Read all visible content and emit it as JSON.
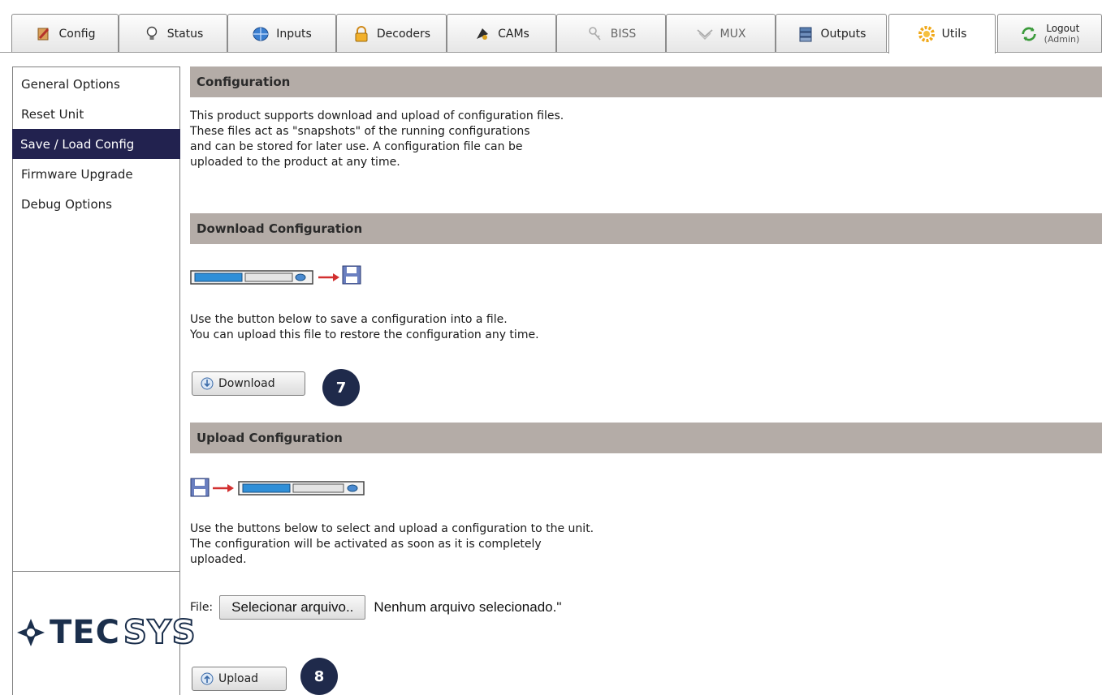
{
  "tabs": [
    {
      "label": "Config",
      "icon": "config-icon"
    },
    {
      "label": "Status",
      "icon": "bulb-icon"
    },
    {
      "label": "Inputs",
      "icon": "globe-icon"
    },
    {
      "label": "Decoders",
      "icon": "lock-icon"
    },
    {
      "label": "CAMs",
      "icon": "cam-icon"
    },
    {
      "label": "BISS",
      "icon": "key-icon"
    },
    {
      "label": "MUX",
      "icon": "mux-icon"
    },
    {
      "label": "Outputs",
      "icon": "server-icon"
    },
    {
      "label": "Utils",
      "icon": "gear-icon"
    }
  ],
  "logout": {
    "label": "Logout",
    "user": "(Admin)"
  },
  "active_tab": "Utils",
  "sidebar": {
    "items": [
      {
        "label": "General Options"
      },
      {
        "label": "Reset Unit"
      },
      {
        "label": "Save / Load Config"
      },
      {
        "label": "Firmware Upgrade"
      },
      {
        "label": "Debug Options"
      }
    ],
    "active": "Save / Load Config"
  },
  "logo": {
    "part1": "TEC",
    "part2": "SYS"
  },
  "sections": {
    "configuration": {
      "title": "Configuration",
      "text": "This product supports download and upload of configuration files.\nThese files act as \"snapshots\" of the running configurations\nand can be stored for later use. A configuration file can be\nuploaded to the product at any time."
    },
    "download": {
      "title": "Download Configuration",
      "text": "Use the button below to save a configuration into a file.\nYou can upload this file to restore the configuration any time.",
      "button_label": "Download",
      "step": "7"
    },
    "upload": {
      "title": "Upload Configuration",
      "text": "Use the buttons below to select and upload a configuration to the unit.\nThe configuration will be activated as soon as it is completely\nuploaded.",
      "file_label": "File:",
      "choose_label": "Selecionar arquivo..",
      "file_status": "Nenhum arquivo selecionado.\"",
      "button_label": "Upload",
      "step": "8"
    }
  },
  "colors": {
    "section_bar": "#b4aca7",
    "sidebar_active": "#22224f",
    "badge": "#1f2a4b",
    "device_blue": "#2f8fd8",
    "arrow_red": "#d23030"
  }
}
